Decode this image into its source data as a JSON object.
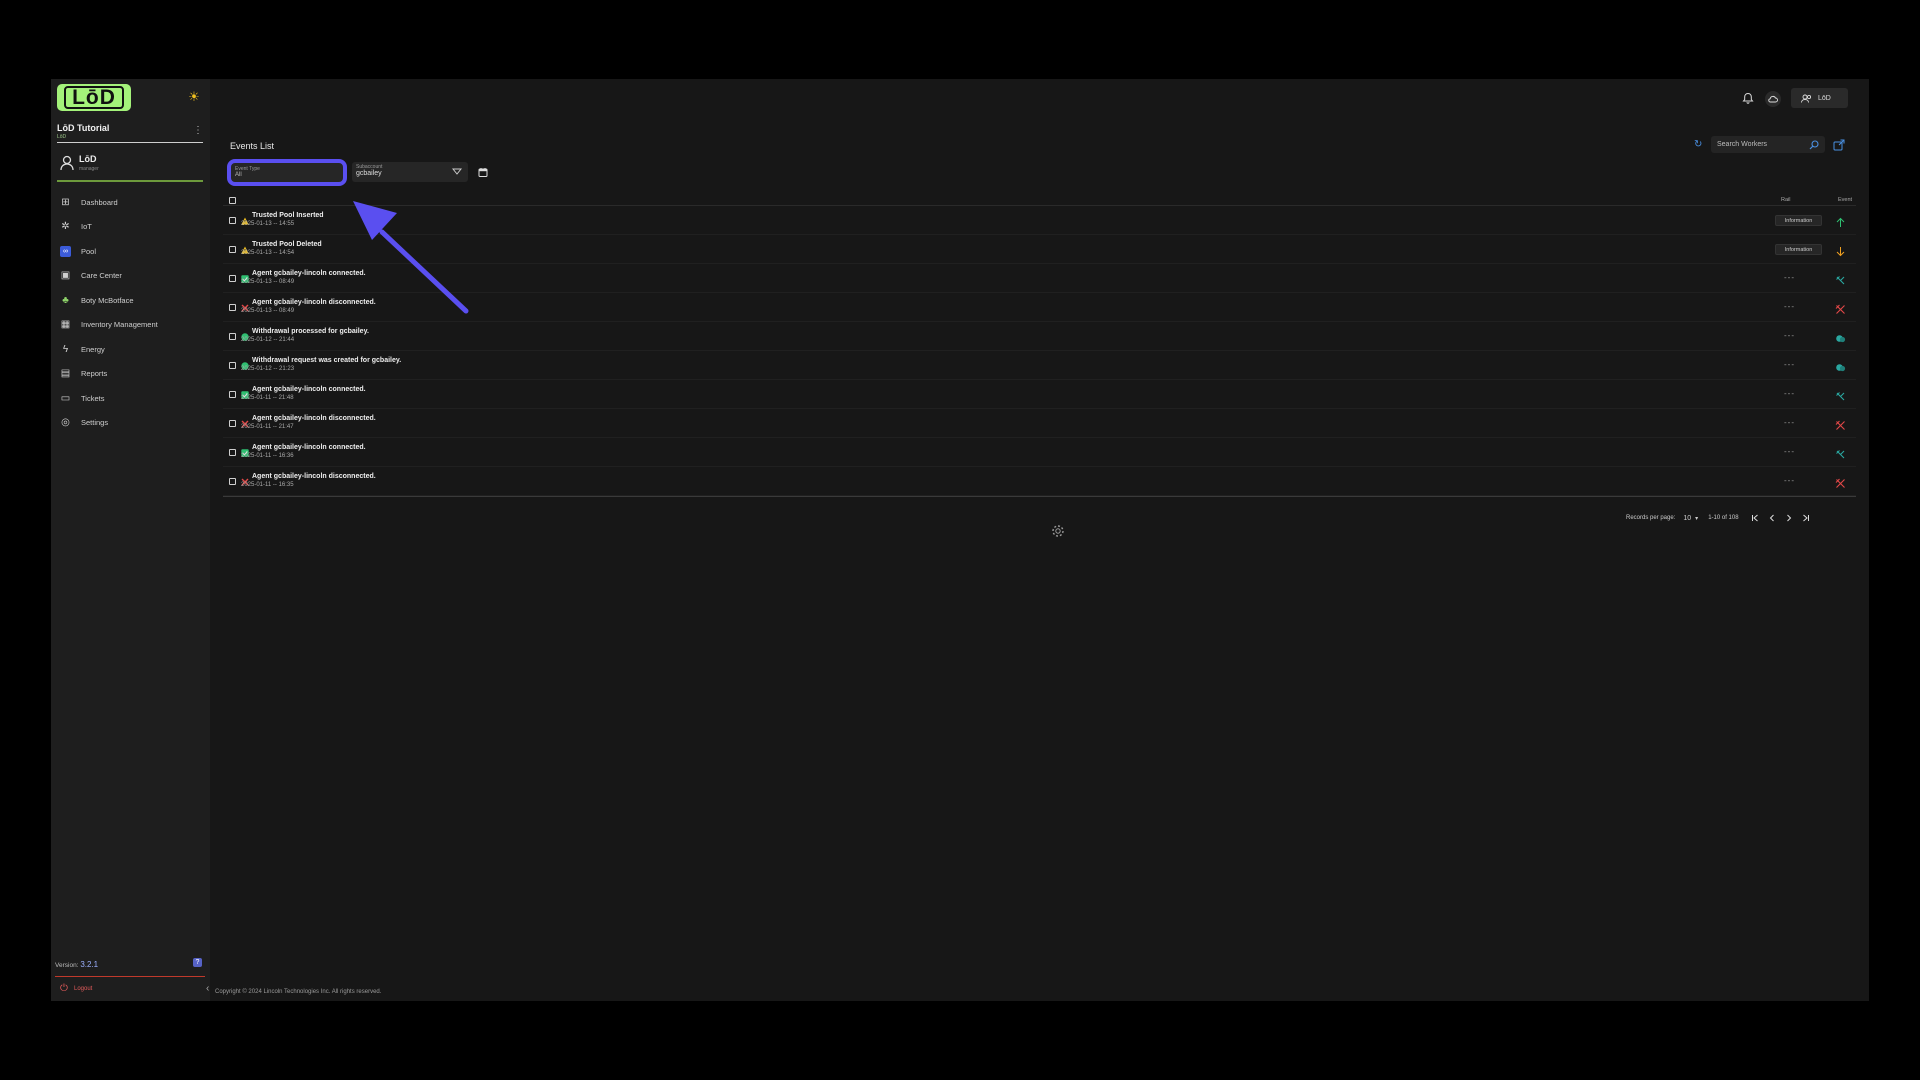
{
  "logo": {
    "text": "LōD"
  },
  "org": {
    "name": "LōD Tutorial",
    "sub": "LōD"
  },
  "user": {
    "name": "LōD",
    "role": "manager"
  },
  "nav": {
    "items": [
      {
        "label": "Dashboard",
        "icon": "dashboard-icon"
      },
      {
        "label": "IoT",
        "icon": "iot-icon"
      },
      {
        "label": "Pool",
        "icon": "pool-icon"
      },
      {
        "label": "Care Center",
        "icon": "care-center-icon"
      },
      {
        "label": "Boty McBotface",
        "icon": "bot-icon"
      },
      {
        "label": "Inventory Management",
        "icon": "inventory-icon"
      },
      {
        "label": "Energy",
        "icon": "energy-icon"
      },
      {
        "label": "Reports",
        "icon": "reports-icon"
      },
      {
        "label": "Tickets",
        "icon": "tickets-icon"
      },
      {
        "label": "Settings",
        "icon": "settings-icon"
      }
    ],
    "active": "Pool"
  },
  "footer": {
    "version_label": "Version:",
    "version": "3.2.1",
    "logout": "Logout"
  },
  "topbar": {
    "user_label": "LōD"
  },
  "content": {
    "title": "Events List",
    "search_placeholder": "Search Workers"
  },
  "filters": {
    "event_type": {
      "label": "Event Type",
      "value": "All"
    },
    "subaccount": {
      "label": "Subaccount",
      "value": "gcbailey"
    }
  },
  "table": {
    "columns": {
      "rail": "Rail",
      "event": "Event"
    },
    "rows": [
      {
        "status": "warning",
        "title": "Trusted Pool Inserted",
        "time": "2025-01-13 -- 14:55",
        "rail": "Information",
        "event": "arrow-up"
      },
      {
        "status": "warning",
        "title": "Trusted Pool Deleted",
        "time": "2025-01-13 -- 14:54",
        "rail": "Information",
        "event": "arrow-down"
      },
      {
        "status": "ok",
        "title": "Agent gcbailey-lincoln connected.",
        "time": "2025-01-13 -- 08:49",
        "rail": "---",
        "event": "connected"
      },
      {
        "status": "error",
        "title": "Agent gcbailey-lincoln disconnected.",
        "time": "2025-01-13 -- 08:49",
        "rail": "---",
        "event": "disconnected"
      },
      {
        "status": "money",
        "title": "Withdrawal processed for gcbailey.",
        "time": "2025-01-12 -- 21:44",
        "rail": "---",
        "event": "coins"
      },
      {
        "status": "money",
        "title": "Withdrawal request was created for gcbailey.",
        "time": "2025-01-12 -- 21:23",
        "rail": "---",
        "event": "coins"
      },
      {
        "status": "ok",
        "title": "Agent gcbailey-lincoln connected.",
        "time": "2025-01-11 -- 21:48",
        "rail": "---",
        "event": "connected"
      },
      {
        "status": "error",
        "title": "Agent gcbailey-lincoln disconnected.",
        "time": "2025-01-11 -- 21:47",
        "rail": "---",
        "event": "disconnected"
      },
      {
        "status": "ok",
        "title": "Agent gcbailey-lincoln connected.",
        "time": "2025-01-11 -- 16:36",
        "rail": "---",
        "event": "connected"
      },
      {
        "status": "error",
        "title": "Agent gcbailey-lincoln disconnected.",
        "time": "2025-01-11 -- 16:35",
        "rail": "---",
        "event": "disconnected"
      }
    ]
  },
  "pager": {
    "records_label": "Records per page:",
    "per_page": "10",
    "range": "1-10 of 108"
  },
  "copyright": "Copyright © 2024 Lincoln Technologies Inc. All rights reserved.",
  "colors": {
    "accent": "#a4f27a",
    "highlight": "#5a4ff0",
    "success": "#2fbf71",
    "error": "#e34848",
    "warning": "#f0c020"
  }
}
